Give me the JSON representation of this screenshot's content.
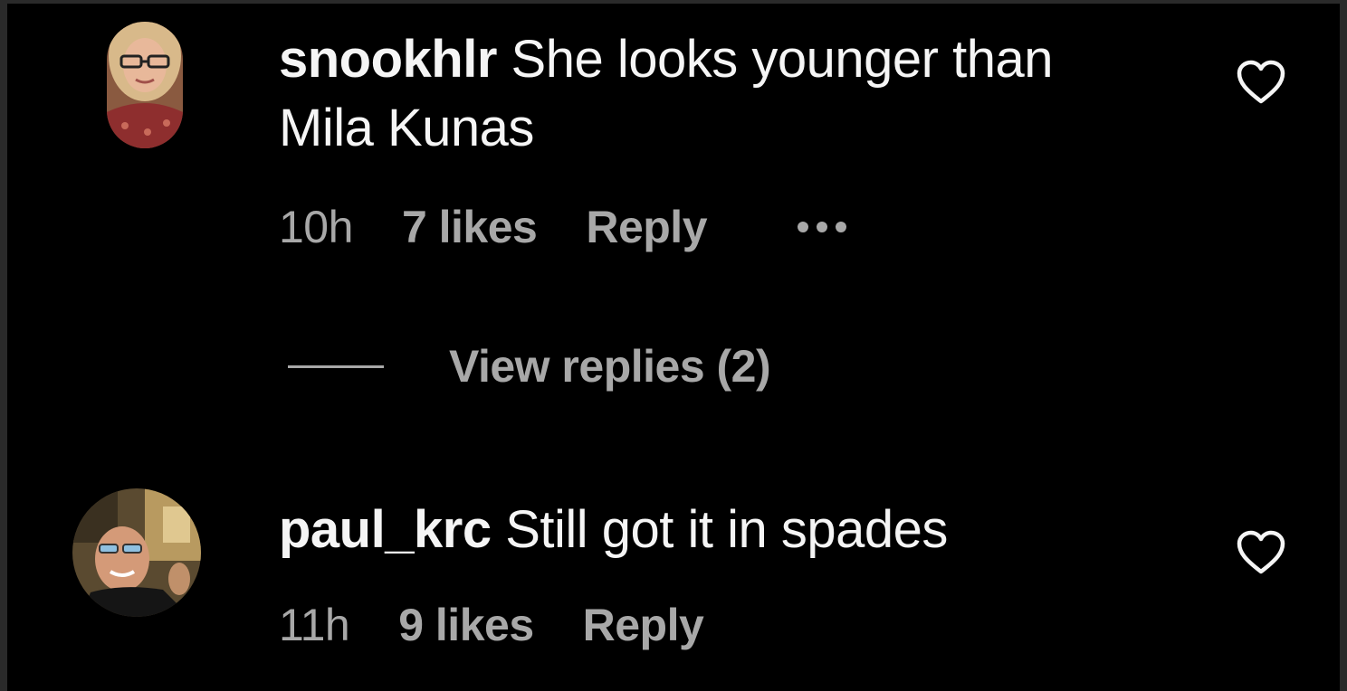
{
  "comments": [
    {
      "username": "snookhlr",
      "text": "She looks younger than",
      "text_line2": "Mila Kunas",
      "time": "10h",
      "likes": "7 likes",
      "reply_label": "Reply",
      "view_replies": "View replies (2)",
      "avatar_icon": "avatar-woman-glasses"
    },
    {
      "username": "paul_krc",
      "text": "Still got it in spades",
      "time": "11h",
      "likes": "9 likes",
      "reply_label": "Reply",
      "avatar_icon": "avatar-man-glasses"
    }
  ],
  "colors": {
    "background": "#000000",
    "primary_text": "#f5f5f5",
    "secondary_text": "#a8a8a8",
    "frame": "#2a2a2a"
  },
  "icons": {
    "like": "heart-outline-icon",
    "more": "more-horizontal-icon"
  }
}
